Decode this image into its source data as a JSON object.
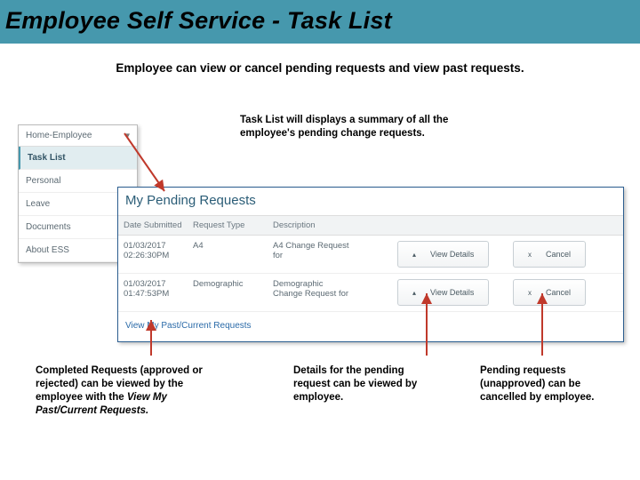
{
  "banner": {
    "title": "Employee Self Service - Task List"
  },
  "intro": "Employee can view or cancel pending requests and view past requests.",
  "sidebar": {
    "header": "Home-Employee",
    "items": [
      "Task List",
      "Personal",
      "Leave",
      "Documents",
      "About ESS"
    ]
  },
  "description_top": "Task List will displays a summary of all the employee's pending change requests.",
  "panel": {
    "title": "My Pending Requests",
    "headers": {
      "date": "Date Submitted",
      "type": "Request Type",
      "desc": "Description"
    },
    "rows": [
      {
        "date_line1": "01/03/2017",
        "date_line2": "02:26:30PM",
        "type": "A4",
        "desc_line1": "A4 Change Request",
        "desc_line2": "for"
      },
      {
        "date_line1": "01/03/2017",
        "date_line2": "01:47:53PM",
        "type": "Demographic",
        "desc_line1": "Demographic",
        "desc_line2": "Change Request for"
      }
    ],
    "btn_view": "View Details",
    "btn_cancel": "Cancel",
    "link": "View My Past/Current Requests"
  },
  "callouts": {
    "c1a": "Completed Requests (approved or rejected) can be viewed by the employee with the ",
    "c1b": "View My Past/Current Requests.",
    "c2": "Details for the pending request can be viewed by employee.",
    "c3": "Pending requests (unapproved) can be cancelled by employee."
  },
  "glyphs": {
    "chevron": "▾",
    "bullet": "▴",
    "x": "x"
  },
  "colors": {
    "accent": "#4698ad",
    "arrow": "#c0392b"
  }
}
